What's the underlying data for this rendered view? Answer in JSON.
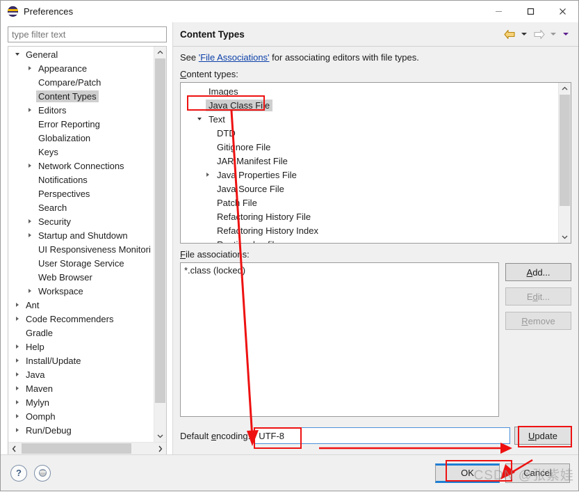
{
  "window": {
    "title": "Preferences",
    "icon": "eclipse-icon",
    "controls": {
      "minimize": "minimize-icon",
      "maximize": "maximize-icon",
      "close": "close-icon"
    }
  },
  "sidebar": {
    "filter": {
      "placeholder": "type filter text",
      "value": ""
    },
    "items": [
      {
        "label": "General",
        "level": 0,
        "state": "expanded"
      },
      {
        "label": "Appearance",
        "level": 1,
        "state": "collapsed"
      },
      {
        "label": "Compare/Patch",
        "level": 1,
        "state": "leaf"
      },
      {
        "label": "Content Types",
        "level": 1,
        "state": "leaf",
        "selected": true
      },
      {
        "label": "Editors",
        "level": 1,
        "state": "collapsed"
      },
      {
        "label": "Error Reporting",
        "level": 1,
        "state": "leaf"
      },
      {
        "label": "Globalization",
        "level": 1,
        "state": "leaf"
      },
      {
        "label": "Keys",
        "level": 1,
        "state": "leaf"
      },
      {
        "label": "Network Connections",
        "level": 1,
        "state": "collapsed"
      },
      {
        "label": "Notifications",
        "level": 1,
        "state": "leaf"
      },
      {
        "label": "Perspectives",
        "level": 1,
        "state": "leaf"
      },
      {
        "label": "Search",
        "level": 1,
        "state": "leaf"
      },
      {
        "label": "Security",
        "level": 1,
        "state": "collapsed"
      },
      {
        "label": "Startup and Shutdown",
        "level": 1,
        "state": "collapsed"
      },
      {
        "label": "UI Responsiveness Monitori",
        "level": 1,
        "state": "leaf"
      },
      {
        "label": "User Storage Service",
        "level": 1,
        "state": "leaf"
      },
      {
        "label": "Web Browser",
        "level": 1,
        "state": "leaf"
      },
      {
        "label": "Workspace",
        "level": 1,
        "state": "collapsed"
      },
      {
        "label": "Ant",
        "level": 0,
        "state": "collapsed"
      },
      {
        "label": "Code Recommenders",
        "level": 0,
        "state": "collapsed"
      },
      {
        "label": "Gradle",
        "level": 0,
        "state": "leaf"
      },
      {
        "label": "Help",
        "level": 0,
        "state": "collapsed"
      },
      {
        "label": "Install/Update",
        "level": 0,
        "state": "collapsed"
      },
      {
        "label": "Java",
        "level": 0,
        "state": "collapsed"
      },
      {
        "label": "Maven",
        "level": 0,
        "state": "collapsed"
      },
      {
        "label": "Mylyn",
        "level": 0,
        "state": "collapsed"
      },
      {
        "label": "Oomph",
        "level": 0,
        "state": "collapsed"
      },
      {
        "label": "Run/Debug",
        "level": 0,
        "state": "collapsed"
      }
    ],
    "scroll": {
      "vertical_up": "chevron-up-icon",
      "vertical_down": "chevron-down-icon",
      "horizontal_left": "chevron-left-icon",
      "horizontal_right": "chevron-right-icon"
    }
  },
  "page": {
    "title": "Content Types",
    "nav": {
      "back": "back-arrow-icon",
      "back_menu": "chevron-down-icon",
      "forward": "forward-arrow-icon",
      "forward_menu": "chevron-down-icon",
      "view_menu": "chevron-down-icon"
    },
    "description": {
      "prefix": "See ",
      "link": "'File Associations'",
      "suffix": " for associating editors with file types."
    },
    "content_types_label": "Content types:",
    "content_types": [
      {
        "label": "Images",
        "level": 0,
        "state": "leaf"
      },
      {
        "label": "Java Class File",
        "level": 0,
        "state": "leaf",
        "selected": true
      },
      {
        "label": "Text",
        "level": 0,
        "state": "expanded"
      },
      {
        "label": "DTD",
        "level": 1,
        "state": "leaf"
      },
      {
        "label": "Gitignore File",
        "level": 1,
        "state": "leaf"
      },
      {
        "label": "JAR Manifest File",
        "level": 1,
        "state": "leaf"
      },
      {
        "label": "Java Properties File",
        "level": 1,
        "state": "collapsed"
      },
      {
        "label": "Java Source File",
        "level": 1,
        "state": "leaf"
      },
      {
        "label": "Patch File",
        "level": 1,
        "state": "leaf"
      },
      {
        "label": "Refactoring History File",
        "level": 1,
        "state": "leaf"
      },
      {
        "label": "Refactoring History Index",
        "level": 1,
        "state": "leaf"
      },
      {
        "label": "Runtime log files",
        "level": 1,
        "state": "leaf"
      }
    ],
    "file_associations_label": "File associations:",
    "file_associations": [
      "*.class (locked)"
    ],
    "assoc_buttons": [
      {
        "label": "Add...",
        "enabled": true
      },
      {
        "label": "Edit...",
        "enabled": false
      },
      {
        "label": "Remove",
        "enabled": false
      }
    ],
    "encoding": {
      "label": "Default encoding:",
      "value": "UTF-8",
      "update_label": "Update"
    }
  },
  "footer": {
    "help_icon": "question-mark-icon",
    "apply_icon": "eclipse-circle-icon",
    "ok_label": "OK",
    "cancel_label": "Cancel"
  },
  "watermark": "CSDN @张紫娃",
  "colors": {
    "annotation": "#ee1111",
    "link": "#0b3fa8",
    "focus": "#1f7fd4",
    "selection": "#cfcfcf"
  }
}
